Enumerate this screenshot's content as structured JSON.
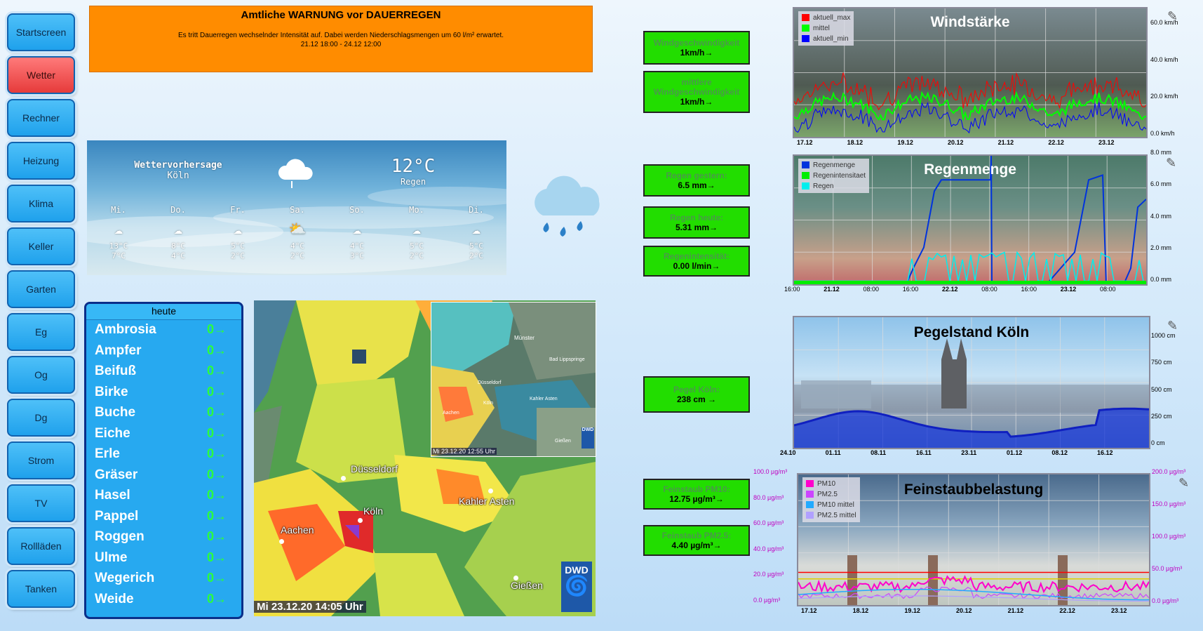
{
  "nav": [
    "Startscreen",
    "Wetter",
    "Rechner",
    "Heizung",
    "Klima",
    "Keller",
    "Garten",
    "Eg",
    "Og",
    "Dg",
    "Strom",
    "TV",
    "Rollläden",
    "Tanken"
  ],
  "nav_active": "Wetter",
  "warning": {
    "title": "Amtliche WARNUNG vor DAUERREGEN",
    "line1": "Es tritt Dauerregen wechselnder Intensität auf. Dabei werden Niederschlagsmengen um 60 l/m² erwartet.",
    "line2": "21.12 18:00 - 24.12 12:00"
  },
  "forecast": {
    "heading": "Wettervorhersage",
    "city": "Köln",
    "temp": "12°C",
    "cond": "Regen",
    "days": [
      {
        "d": "Mi.",
        "hi": "13°C",
        "lo": "7°C"
      },
      {
        "d": "Do.",
        "hi": "8°C",
        "lo": "4°C"
      },
      {
        "d": "Fr.",
        "hi": "5°C",
        "lo": "2°C"
      },
      {
        "d": "Sa.",
        "hi": "4°C",
        "lo": "2°C"
      },
      {
        "d": "So.",
        "hi": "4°C",
        "lo": "3°C"
      },
      {
        "d": "Mo.",
        "hi": "5°C",
        "lo": "2°C"
      },
      {
        "d": "Di.",
        "hi": "5°C",
        "lo": "2°C"
      }
    ]
  },
  "pollen": {
    "header": "heute",
    "items": [
      {
        "n": "Ambrosia",
        "v": "0→"
      },
      {
        "n": "Ampfer",
        "v": "0→"
      },
      {
        "n": "Beifuß",
        "v": "0→"
      },
      {
        "n": "Birke",
        "v": "0→"
      },
      {
        "n": "Buche",
        "v": "0→"
      },
      {
        "n": "Eiche",
        "v": "0→"
      },
      {
        "n": "Erle",
        "v": "0→"
      },
      {
        "n": "Gräser",
        "v": "0→"
      },
      {
        "n": "Hasel",
        "v": "0→"
      },
      {
        "n": "Pappel",
        "v": "0→"
      },
      {
        "n": "Roggen",
        "v": "0→"
      },
      {
        "n": "Ulme",
        "v": "0→"
      },
      {
        "n": "Wegerich",
        "v": "0→"
      },
      {
        "n": "Weide",
        "v": "0→"
      }
    ]
  },
  "radar": {
    "cities": {
      "duesseldorf": "Düsseldorf",
      "koeln": "Köln",
      "aachen": "Aachen",
      "kahler": "Kahler Asten",
      "giessen": "Gießen"
    },
    "inset_cities": {
      "muenster": "Münster",
      "lippspringe": "Bad Lippspringe",
      "duesseldorf": "Düsseldorf",
      "koeln": "Köln",
      "aachen": "Aachen",
      "kahler": "Kahler Asten",
      "giessen": "Gießen"
    },
    "logo": "DWD",
    "timestamp": "Mi 23.12.20  14:05 Uhr",
    "inset_timestamp": "Mi 23.12.20  12:55 Uhr"
  },
  "readings": {
    "wind": {
      "label": "Windgeschwindigkeit",
      "value": "1km/h→"
    },
    "wind_avg": {
      "label": "mittlere Windgeschwindigkeit",
      "value": "1km/h→"
    },
    "rain_yesterday": {
      "label": "Regen gestern:",
      "value": "6.5 mm→"
    },
    "rain_today": {
      "label": "Regen heute:",
      "value": "5.31 mm→"
    },
    "rain_intensity": {
      "label": "Regenintensität:",
      "value": "0.00 l/min→"
    },
    "pegel": {
      "label": "Pegel Köln:",
      "value": "238 cm →"
    },
    "pm10": {
      "label": "Feinstaub PM10:",
      "value": "12.75 µg/m³→"
    },
    "pm25": {
      "label": "Feinstaub PM2.5:",
      "value": "4.40 µg/m³→"
    }
  },
  "chart_data": [
    {
      "type": "line",
      "title": "Windstärke",
      "series": [
        {
          "name": "aktuell_max",
          "color": "#ff0000"
        },
        {
          "name": "mittel",
          "color": "#00ff00"
        },
        {
          "name": "aktuell_min",
          "color": "#0000ff"
        }
      ],
      "x_ticks": [
        "17.12",
        "18.12",
        "19.12",
        "20.12",
        "21.12",
        "22.12",
        "23.12"
      ],
      "y_ticks": [
        "60.0 km/h",
        "40.0 km/h",
        "20.0 km/h",
        "0.0 km/h"
      ],
      "ylim": [
        0,
        70
      ]
    },
    {
      "type": "line",
      "title": "Regenmenge",
      "series": [
        {
          "name": "Regenmenge",
          "color": "#0033dd"
        },
        {
          "name": "Regenintensitaet",
          "color": "#00ee00"
        },
        {
          "name": "Regen",
          "color": "#00eeee"
        }
      ],
      "x_ticks": [
        {
          "t": "16:00",
          "b": false
        },
        {
          "t": "21.12",
          "b": true
        },
        {
          "t": "08:00",
          "b": false
        },
        {
          "t": "16:00",
          "b": false
        },
        {
          "t": "22.12",
          "b": true
        },
        {
          "t": "08:00",
          "b": false
        },
        {
          "t": "16:00",
          "b": false
        },
        {
          "t": "23.12",
          "b": true
        },
        {
          "t": "08:00",
          "b": false
        }
      ],
      "y_ticks": [
        "8.0 mm",
        "6.0 mm",
        "4.0 mm",
        "2.0 mm",
        "0.0 mm"
      ],
      "ylim": [
        0,
        8
      ]
    },
    {
      "type": "line",
      "title": "Pegelstand Köln",
      "x_ticks": [
        "24.10",
        "01.11",
        "08.11",
        "16.11",
        "23.11",
        "01.12",
        "08.12",
        "16.12"
      ],
      "y_ticks": [
        "1000 cm",
        "750 cm",
        "500 cm",
        "250 cm",
        "0 cm"
      ],
      "ylim": [
        0,
        1100
      ]
    },
    {
      "type": "line",
      "title": "Feinstaubbelastung",
      "series": [
        {
          "name": "PM10",
          "color": "#ff00cc"
        },
        {
          "name": "PM2.5",
          "color": "#cc44ff"
        },
        {
          "name": "PM10 mittel",
          "color": "#22aaff"
        },
        {
          "name": "PM2.5 mittel",
          "color": "#b0a0ff"
        }
      ],
      "x_ticks": [
        "17.12",
        "18.12",
        "19.12",
        "20.12",
        "21.12",
        "22.12",
        "23.12"
      ],
      "y_left": [
        "100.0 µg/m³",
        "80.0 µg/m³",
        "60.0 µg/m³",
        "40.0 µg/m³",
        "20.0 µg/m³",
        "0.0 µg/m³"
      ],
      "y_right": [
        "200.0 µg/m³",
        "150.0 µg/m³",
        "100.0 µg/m³",
        "50.0 µg/m³",
        "0.0 µg/m³"
      ],
      "ylim": [
        0,
        100
      ]
    }
  ]
}
